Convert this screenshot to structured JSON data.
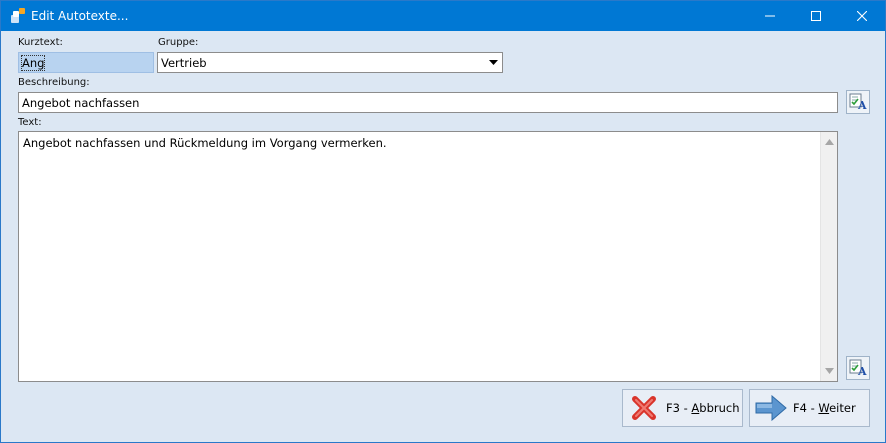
{
  "window": {
    "title": "Edit Autotexte...",
    "accent_color": "#0078d4"
  },
  "form": {
    "kurztext": {
      "label": "Kurztext:",
      "value": "Ang"
    },
    "gruppe": {
      "label": "Gruppe:",
      "value": "Vertrieb"
    },
    "beschreibung": {
      "label": "Beschreibung:",
      "value": "Angebot nachfassen"
    },
    "text": {
      "label": "Text:",
      "value": "Angebot nachfassen und Rückmeldung im Vorgang vermerken."
    }
  },
  "buttons": {
    "cancel": {
      "prefix": "F3 - ",
      "mnemonic": "A",
      "rest": "bbruch",
      "icon": "red-x-icon"
    },
    "next": {
      "prefix": "F4 - ",
      "mnemonic": "W",
      "rest": "eiter",
      "icon": "blue-arrow-right-icon"
    }
  },
  "icons": {
    "app": "app-icon",
    "minimize": "minimize-icon",
    "maximize": "maximize-icon",
    "close": "close-icon",
    "edit_text": "edit-text-icon"
  }
}
